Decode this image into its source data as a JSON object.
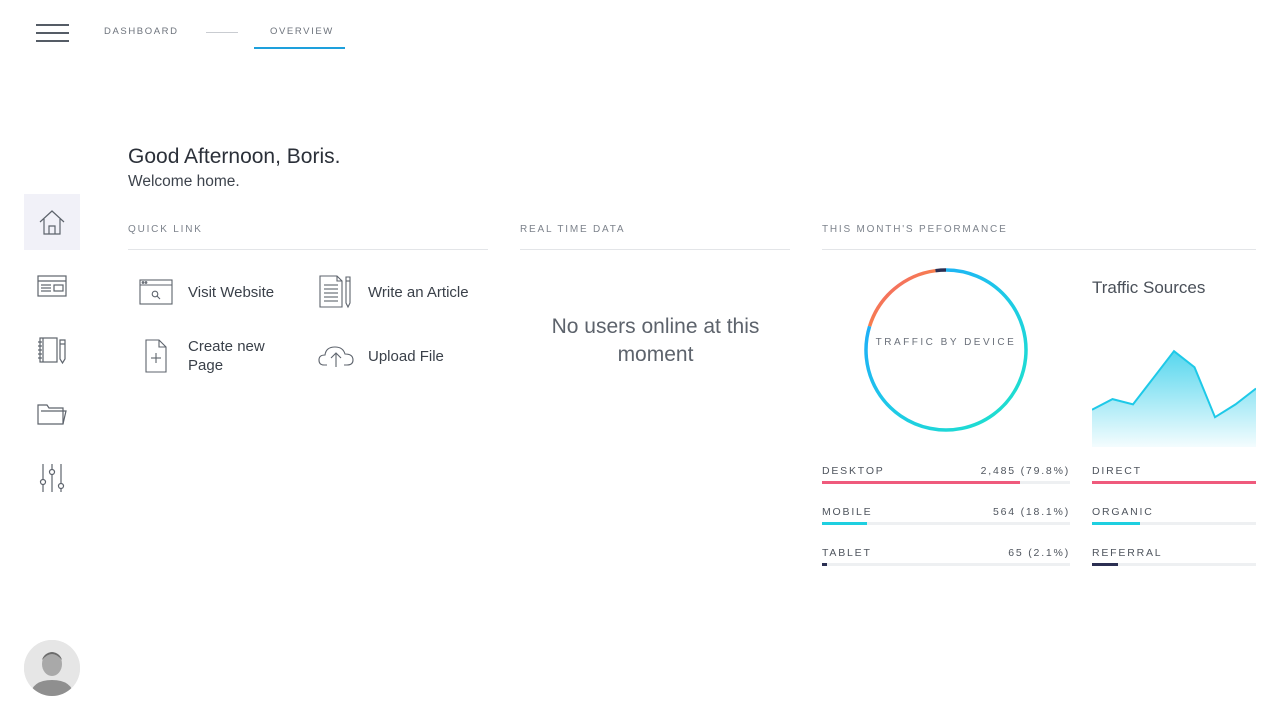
{
  "topnav": {
    "menu_icon": "hamburger-icon",
    "crumbs": [
      "DASHBOARD",
      "OVERVIEW"
    ],
    "active_color": "#1ea0dc"
  },
  "sidebar": {
    "items": [
      {
        "name": "home",
        "icon": "home-icon",
        "active": true
      },
      {
        "name": "browser",
        "icon": "browser-window-icon",
        "active": false
      },
      {
        "name": "notebook",
        "icon": "notebook-pencil-icon",
        "active": false
      },
      {
        "name": "folder",
        "icon": "folder-icon",
        "active": false
      },
      {
        "name": "settings",
        "icon": "sliders-icon",
        "active": false
      }
    ],
    "avatar_icon": "user-avatar"
  },
  "greeting": {
    "title": "Good Afternoon, Boris.",
    "subtitle": "Welcome home."
  },
  "quick_link": {
    "heading": "QUICK LINK",
    "items": [
      {
        "label": "Visit Website",
        "icon": "browser-search-icon"
      },
      {
        "label": "Write an Article",
        "icon": "document-pencil-icon"
      },
      {
        "label": "Create new Page",
        "icon": "new-page-icon"
      },
      {
        "label": "Upload File",
        "icon": "cloud-upload-icon"
      }
    ]
  },
  "real_time": {
    "heading": "REAL TIME DATA",
    "empty_message": "No users online at this moment"
  },
  "performance": {
    "heading": "THIS MONTH'S PEFORMANCE",
    "donut_label": "TRAFFIC BY DEVICE",
    "devices": [
      {
        "name": "DESKTOP",
        "value": "2,485 (79.8%)",
        "fraction": 0.798,
        "color": "#ef5a7c"
      },
      {
        "name": "MOBILE",
        "value": "564 (18.1%)",
        "fraction": 0.181,
        "color": "#1ecfe0"
      },
      {
        "name": "TABLET",
        "value": "65 (2.1%)",
        "fraction": 0.021,
        "color": "#2b2f52"
      }
    ],
    "traffic_sources": {
      "title": "Traffic Sources",
      "series": [
        0.35,
        0.45,
        0.4,
        0.65,
        0.9,
        0.75,
        0.28,
        0.4,
        0.55
      ],
      "color": "#1ec9e8",
      "sources": [
        {
          "name": "DIRECT",
          "fraction": 1.0,
          "color": "#ef5a7c"
        },
        {
          "name": "ORGANIC",
          "fraction": 0.29,
          "color": "#1ecfe0"
        },
        {
          "name": "REFERRAL",
          "fraction": 0.16,
          "color": "#2b2f52"
        }
      ]
    }
  }
}
